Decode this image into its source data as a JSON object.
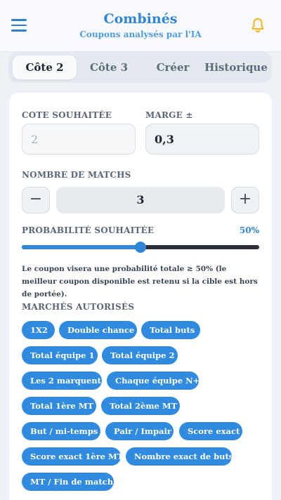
{
  "header": {
    "title": "Combinés",
    "subtitle": "Coupons analysés par l'IA",
    "menu_icon": "hamburger-icon",
    "bell_icon": "bell-icon"
  },
  "tabs": [
    {
      "label": "Côte 2",
      "active": true
    },
    {
      "label": "Côte 3",
      "active": false
    },
    {
      "label": "Créer",
      "active": false
    },
    {
      "label": "Historique",
      "active": false
    }
  ],
  "form": {
    "cote_label": "COTE SOUHAITÉE",
    "cote_placeholder": "2",
    "marge_label": "MARGE ±",
    "marge_value": "0,3",
    "matches_label": "NOMBRE DE MATCHS",
    "matches_minus": "−",
    "matches_value": "3",
    "matches_plus": "+",
    "proba_label": "PROBABILITÉ SOUHAITÉE",
    "proba_value_text": "50%",
    "proba_fraction": 0.5,
    "note": "Le coupon visera une probabilité totale ≥ 50% (le meilleur coupon disponible est retenu si la cible est hors de portée).",
    "markets_label": "MARCHÉS AUTORISÉS",
    "markets": [
      "1X2",
      "Double chance",
      "Total buts",
      "Total équipe 1",
      "Total équipe 2",
      "Les 2 marquent",
      "Chaque équipe N+",
      "Total 1ère MT",
      "Total 2ème MT",
      "But / mi-temps",
      "Pair / Impair",
      "Score exact",
      "Score exact 1ère MT",
      "Nombre exact de buts",
      "MT / Fin de match"
    ]
  },
  "colors": {
    "accent": "#2f86d6",
    "chip": "#2f8ae0",
    "bell": "#f5b522",
    "background": "#eef1f6"
  }
}
